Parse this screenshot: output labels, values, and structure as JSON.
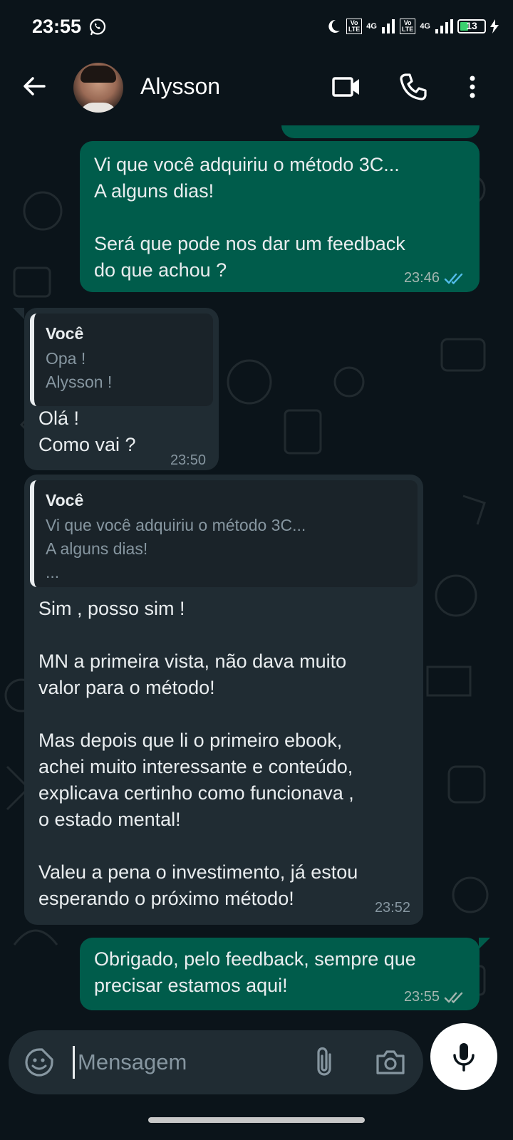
{
  "status_bar": {
    "time": "23:55",
    "battery": "13",
    "network": "4G",
    "volte": "Vo LTE"
  },
  "header": {
    "contact_name": "Alysson"
  },
  "messages": [
    {
      "direction": "out",
      "text": "Vi que você adquiriu o método 3C...\nA alguns dias!\n\nSerá que pode nos dar um feedback\ndo que achou ?",
      "time": "23:46",
      "status": "read"
    },
    {
      "direction": "in",
      "quote_author": "Você",
      "quote_text": "Opa !\nAlysson !",
      "text": "Olá !\nComo vai ?",
      "time": "23:50"
    },
    {
      "direction": "in",
      "quote_author": "Você",
      "quote_text": "Vi que você adquiriu o método 3C...\nA alguns dias!\n...",
      "text": "Sim , posso sim !\n\nMN a primeira vista, não dava muito\nvalor para o método!\n\nMas depois que li o primeiro ebook,\nachei muito interessante e conteúdo,\nexplicava certinho como funcionava ,\no estado mental!\n\nValeu a pena o investimento, já estou\nesperando o próximo método!",
      "time": "23:52"
    },
    {
      "direction": "out",
      "text": "Obrigado, pelo feedback, sempre que\nprecisar estamos aqui!",
      "time": "23:55",
      "status": "delivered"
    }
  ],
  "input": {
    "placeholder": "Mensagem"
  },
  "colors": {
    "background": "#0b141a",
    "outgoing_bubble": "#005c4b",
    "incoming_bubble": "#202c33",
    "read_ticks": "#53bdeb",
    "delivered_ticks": "#a4b6b0"
  }
}
